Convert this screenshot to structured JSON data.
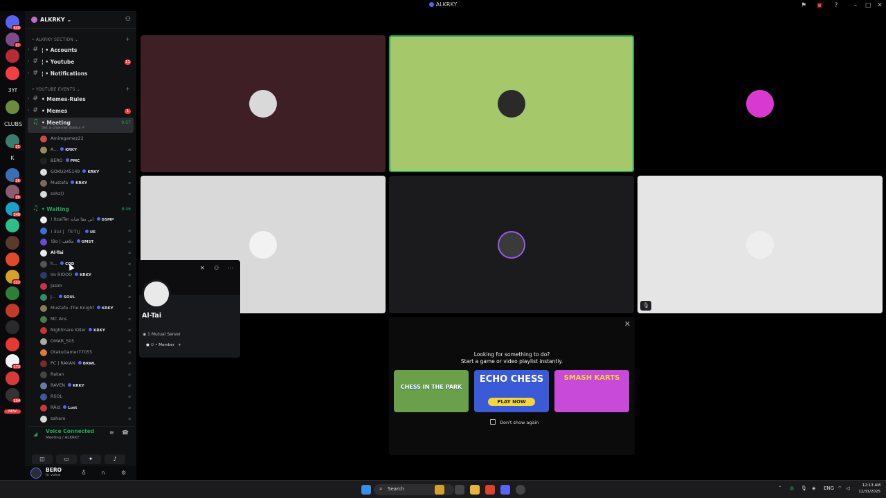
{
  "window": {
    "title": "ALKRKY"
  },
  "rail": {
    "servers": [
      {
        "badge": "440",
        "color": "#5865f2"
      },
      {
        "badge": "17",
        "color": "#7b4b8a"
      },
      {
        "badge": "",
        "color": "#b52a34"
      },
      {
        "badge": "",
        "color": "#f23f43"
      },
      {
        "label": "3Yf"
      },
      {
        "badge": "",
        "color": "#6c8b3c"
      },
      {
        "label": "CLUBS"
      },
      {
        "badge": "21",
        "color": "#3a7d6f"
      },
      {
        "label": "K"
      },
      {
        "badge": "26",
        "color": "#3b6fb5"
      },
      {
        "badge": "20",
        "color": "#8b5c6e"
      },
      {
        "badge": "348",
        "color": "#1aa1c8"
      },
      {
        "badge": "",
        "color": "#2bbf8c"
      },
      {
        "badge": "",
        "color": "#5a3a2a"
      },
      {
        "badge": "",
        "color": "#e04a2c"
      },
      {
        "badge": "122",
        "color": "#d4a12b"
      },
      {
        "badge": "",
        "color": "#2d7f38"
      },
      {
        "badge": "",
        "color": "#c23a2a"
      },
      {
        "badge": "",
        "color": "#2a2a2a"
      },
      {
        "badge": "",
        "color": "#e53935"
      },
      {
        "badge": "173",
        "color": "#f2f3f5"
      },
      {
        "badge": "",
        "color": "#d83a3a"
      },
      {
        "badge": "104",
        "color": "#333"
      },
      {
        "label": "NEW"
      }
    ]
  },
  "guild": {
    "name": "ALKRKY",
    "chevron": "⌄"
  },
  "categories": [
    {
      "label": "• ALKRKY SECTION ⌄"
    },
    {
      "label": "• YOUTUBE EVENTS ⌄"
    }
  ],
  "channels": [
    {
      "name": "¦ • Accounts",
      "badge": ""
    },
    {
      "name": "¦ • Youtube",
      "badge": "11"
    },
    {
      "name": "¦ • Notifications",
      "badge": ""
    },
    {
      "name": "• Memes-Rules",
      "badge": ""
    },
    {
      "name": "• Memes",
      "badge": "1"
    },
    {
      "name": "• Meeting",
      "time": "9:57",
      "sub": "Set a channel status ✐"
    },
    {
      "name": "• Waiting",
      "time": "8:46"
    }
  ],
  "meeting_users": [
    {
      "name": "Amiregamez22",
      "tag": "",
      "color": "#c94a4a"
    },
    {
      "name": "A...",
      "tag": "KRKY",
      "color": "#9a8a5a"
    },
    {
      "name": "BERO",
      "tag": "PMC",
      "color": "#222"
    },
    {
      "name": "GOKU245149",
      "tag": "KRKY",
      "color": "#dddddd"
    },
    {
      "name": "Mustafa",
      "tag": "KRKY",
      "color": "#7a6a5a"
    },
    {
      "name": "sohz()",
      "tag": "",
      "color": "#d9d9d9"
    }
  ],
  "waiting_users": [
    {
      "name": "! itzalTer اني مقا صابه",
      "tag": "DSMP",
      "color": "#eeeeee"
    },
    {
      "name": "! 3ذا!  | 『S'ΤΙ』",
      "tag": "UE",
      "color": "#3a6fd8"
    },
    {
      "name": "!Bo | ملاقف",
      "tag": "GMST",
      "color": "#6a4ad8"
    },
    {
      "name": "Al-Tai",
      "tag": "",
      "color": "#e9e9e9",
      "hl": true
    },
    {
      "name": "h...",
      "tag": "COD",
      "color": "#555"
    },
    {
      "name": "Im RIOOO",
      "tag": "KRKY",
      "color": "#2a3a6a"
    },
    {
      "name": "Jasim",
      "tag": "",
      "color": "#c8324a"
    },
    {
      "name": "J...",
      "tag": "SOUL",
      "color": "#3a8a6a"
    },
    {
      "name": "Mustafa -The Knight",
      "tag": "KRKY",
      "color": "#8a7a5a"
    },
    {
      "name": "MC Ans",
      "tag": "",
      "color": "#4a7a4a"
    },
    {
      "name": "Nightmare Killer",
      "tag": "KRKY",
      "color": "#cc3333"
    },
    {
      "name": "OMAR_505",
      "tag": "",
      "color": "#aaaaaa"
    },
    {
      "name": "OtakuGamer77055",
      "tag": "",
      "color": "#e07a3a"
    },
    {
      "name": "PC | RAKAN",
      "tag": "BRWL",
      "color": "#7a2a2a"
    },
    {
      "name": "Rakan",
      "tag": "",
      "color": "#444"
    },
    {
      "name": "RAVEN",
      "tag": "KRKY",
      "color": "#6a7aa8"
    },
    {
      "name": "RSOL",
      "tag": "",
      "color": "#3a5a9a"
    },
    {
      "name": "RÄid",
      "tag": "Lost",
      "color": "#c83a3a"
    },
    {
      "name": "saharo",
      "tag": "",
      "color": "#d9d9d9"
    }
  ],
  "voice_panel": {
    "status": "Voice Connected",
    "location": "Meeting / ALKRKY"
  },
  "user": {
    "name": "BERO",
    "status": "In voice"
  },
  "tiles": [
    {
      "bg": "#3d1f25",
      "av": "#d9d9d9",
      "speaking": false
    },
    {
      "bg": "#a5c86a",
      "av": "#2a2a2a",
      "speaking": true
    },
    {
      "bg": "#000000",
      "av": "#d83ad1",
      "speaking": false
    },
    {
      "bg": "#d9d9d9",
      "av": "#f2f2f2",
      "speaking": false
    },
    {
      "bg": "#1b1b1d",
      "av": "#3a3a3a",
      "speaking": false
    },
    {
      "bg": "#e5e5e5",
      "av": "#eeeeee",
      "speaking": false
    }
  ],
  "activity": {
    "line1": "Looking for something to do?",
    "line2": "Start a game or video playlist instantly.",
    "cards": [
      {
        "title": "CHESS IN THE PARK",
        "bg": "#6aa04a"
      },
      {
        "title": "ECHO CHESS",
        "sub": "PLAY NOW",
        "bg": "#3a5ad8"
      },
      {
        "title": "SMASH KARTS",
        "bg": "#c84ad8"
      }
    ],
    "dont_show": "Don't show again"
  },
  "popout": {
    "name": "Al-Tai",
    "mutual": "1 Mutual Server",
    "role": "• Member"
  },
  "taskbar": {
    "search": "Search",
    "lang": "ENG",
    "time": "12:13 AM",
    "date": "12/31/2025"
  }
}
